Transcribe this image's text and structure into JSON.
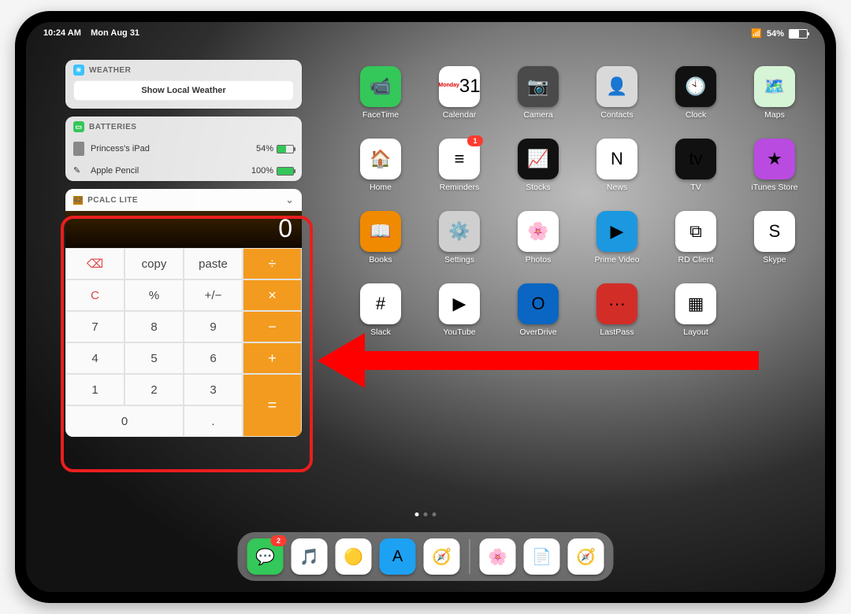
{
  "status": {
    "time": "10:24 AM",
    "date": "Mon Aug 31",
    "battery_pct": "54%"
  },
  "widgets": {
    "weather": {
      "title": "WEATHER",
      "button": "Show Local Weather",
      "icon_color": "#3ac3ff"
    },
    "batteries": {
      "title": "BATTERIES",
      "icon_color": "#34c759",
      "items": [
        {
          "name": "Princess's iPad",
          "pct": "54%",
          "fill": 54,
          "color": "#34c759"
        },
        {
          "name": "Apple Pencil",
          "pct": "100%",
          "fill": 100,
          "color": "#34c759"
        }
      ]
    },
    "pcalc": {
      "title": "PCALC LITE",
      "display": "0",
      "keys": [
        "⌫",
        "copy",
        "paste",
        "÷",
        "C",
        "%",
        "+/−",
        "×",
        "7",
        "8",
        "9",
        "−",
        "4",
        "5",
        "6",
        "+",
        "1",
        "2",
        "3",
        "=",
        "0",
        "."
      ]
    }
  },
  "apps": [
    {
      "label": "FaceTime",
      "bg": "#34c759",
      "glyph": "📹"
    },
    {
      "label": "Calendar",
      "bg": "#fff",
      "glyph": "31",
      "sub": "Monday"
    },
    {
      "label": "Camera",
      "bg": "#4a4a4a",
      "glyph": "📷"
    },
    {
      "label": "Contacts",
      "bg": "#d9d9d9",
      "glyph": "👤"
    },
    {
      "label": "Clock",
      "bg": "#111",
      "glyph": "🕙"
    },
    {
      "label": "Maps",
      "bg": "#d6f5d6",
      "glyph": "🗺️"
    },
    {
      "label": "Home",
      "bg": "#fff",
      "glyph": "🏠"
    },
    {
      "label": "Reminders",
      "bg": "#fff",
      "glyph": "≡",
      "badge": "1"
    },
    {
      "label": "Stocks",
      "bg": "#111",
      "glyph": "📈"
    },
    {
      "label": "News",
      "bg": "#fff",
      "glyph": "N"
    },
    {
      "label": "TV",
      "bg": "#111",
      "glyph": "tv"
    },
    {
      "label": "iTunes Store",
      "bg": "#b94be0",
      "glyph": "★"
    },
    {
      "label": "Books",
      "bg": "#f08a00",
      "glyph": "📖"
    },
    {
      "label": "Settings",
      "bg": "#cfcfcf",
      "glyph": "⚙️"
    },
    {
      "label": "Photos",
      "bg": "#fff",
      "glyph": "🌸"
    },
    {
      "label": "Prime Video",
      "bg": "#1b98e0",
      "glyph": "▶"
    },
    {
      "label": "RD Client",
      "bg": "#fff",
      "glyph": "⧉"
    },
    {
      "label": "Skype",
      "bg": "#fff",
      "glyph": "S"
    },
    {
      "label": "Slack",
      "bg": "#fff",
      "glyph": "#"
    },
    {
      "label": "YouTube",
      "bg": "#fff",
      "glyph": "▶"
    },
    {
      "label": "OverDrive",
      "bg": "#0a66c2",
      "glyph": "O"
    },
    {
      "label": "LastPass",
      "bg": "#d32d27",
      "glyph": "···"
    },
    {
      "label": "Layout",
      "bg": "#fff",
      "glyph": "▦"
    }
  ],
  "dock": [
    {
      "name": "Messages",
      "bg": "#34c759",
      "glyph": "💬",
      "badge": "2"
    },
    {
      "name": "Music",
      "bg": "#fff",
      "glyph": "🎵"
    },
    {
      "name": "Chrome",
      "bg": "#fff",
      "glyph": "🟡"
    },
    {
      "name": "App Store",
      "bg": "#1da1f2",
      "glyph": "A"
    },
    {
      "name": "Safari",
      "bg": "#fff",
      "glyph": "🧭"
    }
  ],
  "dock_recent": [
    {
      "name": "Photos",
      "bg": "#fff",
      "glyph": "🌸"
    },
    {
      "name": "Docs",
      "bg": "#fff",
      "glyph": "📄"
    },
    {
      "name": "Safari",
      "bg": "#fff",
      "glyph": "🧭"
    }
  ]
}
